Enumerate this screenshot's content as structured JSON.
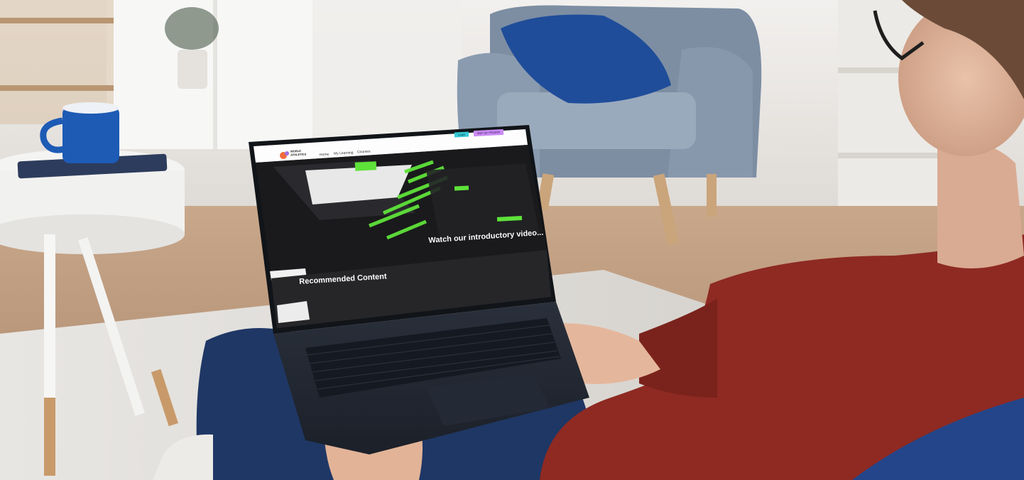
{
  "website": {
    "brand": "WORLD ATHLETICS",
    "nav": [
      "Home",
      "My Learning",
      "Courses"
    ],
    "header_actions": {
      "login_label": "Login",
      "signup_label": "Sign Up / Register"
    },
    "hero_caption": "Watch our introductory video...",
    "section_heading": "Recommended Content"
  },
  "colors": {
    "login_button": "#35c9d6",
    "signup_button": "#c98cf3",
    "hero_accent": "#5fe23a",
    "sweater": "#8e2a22",
    "jeans": "#1f3765"
  }
}
